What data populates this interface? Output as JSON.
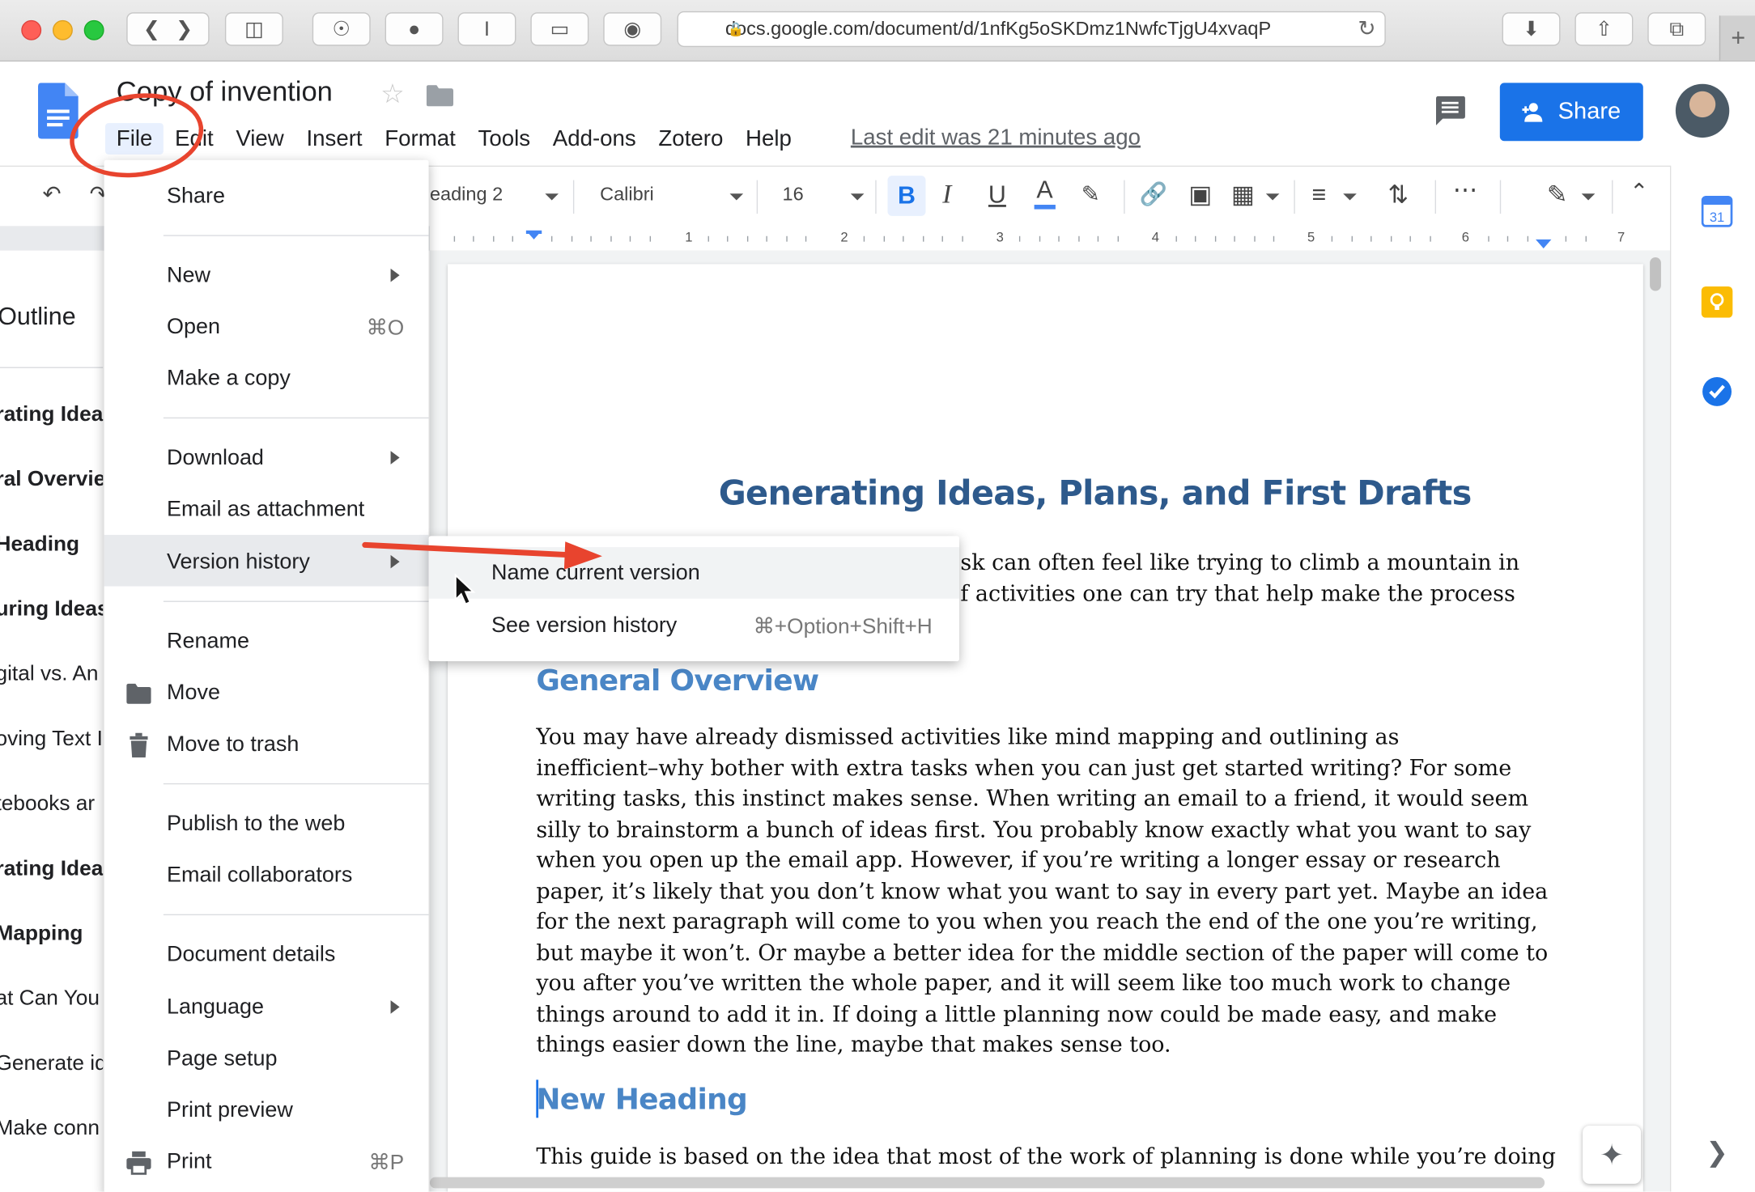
{
  "browser": {
    "url": "docs.google.com/document/d/1nfKg5oSKDmz1NwfcTjgU4xvaqP",
    "newtab_label": "+"
  },
  "doc": {
    "title": "Copy of invention",
    "last_edit": "Last edit was 21 minutes ago",
    "share_label": "Share"
  },
  "menubar": [
    "File",
    "Edit",
    "View",
    "Insert",
    "Format",
    "Tools",
    "Add-ons",
    "Zotero",
    "Help"
  ],
  "toolbar": {
    "style": "eading 2",
    "font": "Calibri",
    "size": "16",
    "bold": "B",
    "italic": "I",
    "underline": "U",
    "text_color": "A",
    "more": "⋯"
  },
  "ruler": [
    "1",
    "2",
    "3",
    "4",
    "5",
    "6",
    "7"
  ],
  "outline": {
    "title": "Outline",
    "items": [
      {
        "label": "rating Idea",
        "bold": true
      },
      {
        "label": "ral Overvie",
        "bold": true
      },
      {
        "label": "Heading",
        "bold": true
      },
      {
        "label": "uring Ideas",
        "bold": true
      },
      {
        "label": "gital vs. An",
        "bold": false
      },
      {
        "label": "oving Text I",
        "bold": false
      },
      {
        "label": "tebooks ar",
        "bold": false
      },
      {
        "label": "rating Idea",
        "bold": true
      },
      {
        "label": "Mapping",
        "bold": true
      },
      {
        "label": "at Can You",
        "bold": false
      },
      {
        "label": "Generate id",
        "bold": false
      },
      {
        "label": "Make conn",
        "bold": false
      }
    ]
  },
  "file_menu": {
    "share": "Share",
    "new": "New",
    "open": "Open",
    "open_shortcut": "⌘O",
    "make_copy": "Make a copy",
    "download": "Download",
    "email_attachment": "Email as attachment",
    "version_history": "Version history",
    "rename": "Rename",
    "move": "Move",
    "trash": "Move to trash",
    "publish": "Publish to the web",
    "email_collab": "Email collaborators",
    "details": "Document details",
    "language": "Language",
    "page_setup": "Page setup",
    "print_preview": "Print preview",
    "print": "Print",
    "print_shortcut": "⌘P"
  },
  "submenu": {
    "name_version": "Name current version",
    "see_history": "See version history",
    "see_history_shortcut": "⌘+Option+Shift+H"
  },
  "content": {
    "heading1": "Generating Ideas, Plans, and First Drafts",
    "intro_lines": [
      "sk can often feel like trying to climb a mountain in",
      "f activities one can try that help make the process"
    ],
    "heading_overview": "General Overview",
    "overview_lines": [
      "You may have already dismissed activities like mind mapping and outlining as",
      "inefficient–why bother with extra tasks when you can just get started writing? For some",
      "writing tasks, this instinct makes sense. When writing an email to a friend, it would seem",
      "silly to brainstorm a bunch of ideas first. You probably know exactly what you want to say",
      "when you open up the email app. However, if you’re writing a longer essay or research",
      "paper, it’s likely that you don’t know what you want to say in every part yet. Maybe an idea",
      "for the next paragraph will come to you when you reach the end of the one you’re writing,",
      "but maybe it won’t. Or maybe a better idea for the middle section of the paper will come to",
      "you after you’ve written the whole paper, and it will seem like too much work to change",
      "things around to add it in. If doing a little planning now could be made easy, and make",
      "things easier down the line, maybe that makes sense too."
    ],
    "heading_new": "New Heading",
    "last_line": "This guide is based on the idea that most of the work of planning is done while you’re doing"
  },
  "colors": {
    "share_blue": "#1a73e8",
    "heading1": "#2e5a8c",
    "heading2": "#4a86c6",
    "annotation_red": "#e8442e"
  }
}
